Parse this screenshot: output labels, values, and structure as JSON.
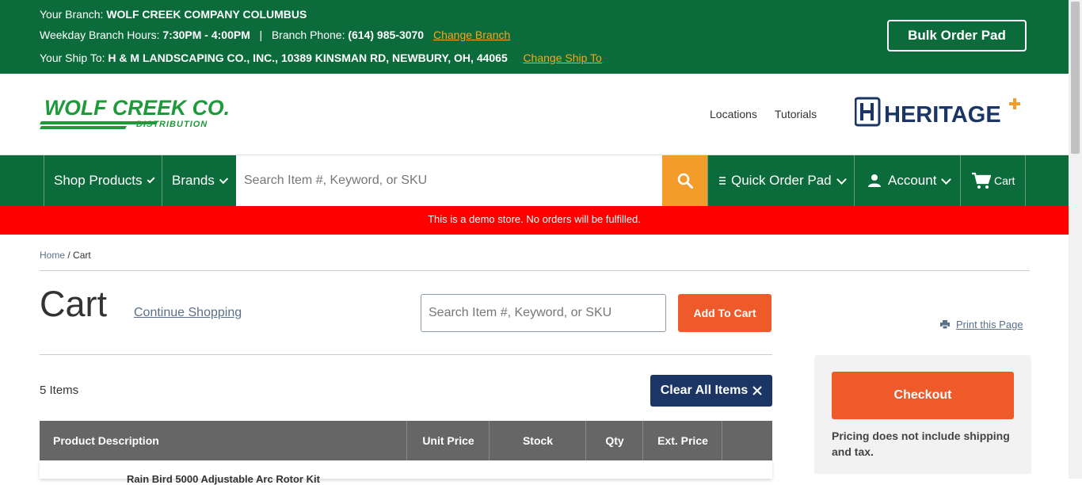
{
  "topbar": {
    "branch_label": "Your Branch:",
    "branch_value": "WOLF CREEK COMPANY COLUMBUS",
    "hours_label": "Weekday Branch Hours:",
    "hours_value": "7:30PM - 4:00PM",
    "separator": "|",
    "phone_label": "Branch Phone:",
    "phone_value": "(614) 985-3070",
    "change_branch": "Change Branch",
    "shipto_label": "Your Ship To:",
    "shipto_value": "H & M LANDSCAPING CO., INC., 10389 KINSMAN RD, NEWBURY, OH, 44065",
    "change_shipto": "Change Ship To",
    "bulk_order": "Bulk Order Pad"
  },
  "header": {
    "logo_text": "WOLF CREEK CO.",
    "logo_subtext": "DISTRIBUTION",
    "links": [
      "Locations",
      "Tutorials"
    ],
    "partner_logo": "HERITAGE"
  },
  "nav": {
    "shop_products": "Shop Products",
    "brands": "Brands",
    "search_placeholder": "Search Item #, Keyword, or SKU",
    "quick_order": "Quick Order Pad",
    "account": "Account",
    "cart": "Cart"
  },
  "demo_banner": "This is a demo store. No orders will be fulfilled.",
  "breadcrumb": {
    "home": "Home",
    "sep": " / ",
    "current": "Cart"
  },
  "cart": {
    "title": "Cart",
    "continue": "Continue Shopping",
    "search_placeholder": "Search Item #, Keyword, or SKU",
    "add_to_cart": "Add To Cart",
    "print": "Print this Page",
    "items_count": "5 Items",
    "clear_all": "Clear All Items",
    "columns": [
      "Product Description",
      "Unit Price",
      "Stock",
      "Qty",
      "Ext. Price"
    ],
    "first_row_peek": "Rain Bird 5000 Adjustable Arc Rotor Kit"
  },
  "summary": {
    "checkout": "Checkout",
    "pricing_note": "Pricing does not include shipping and tax."
  },
  "colors": {
    "brand_green": "#0b6b3a",
    "search_orange": "#f39c2a",
    "action_orange": "#ef5a2a",
    "navy": "#1b3564",
    "demo_red": "#ff0000"
  }
}
